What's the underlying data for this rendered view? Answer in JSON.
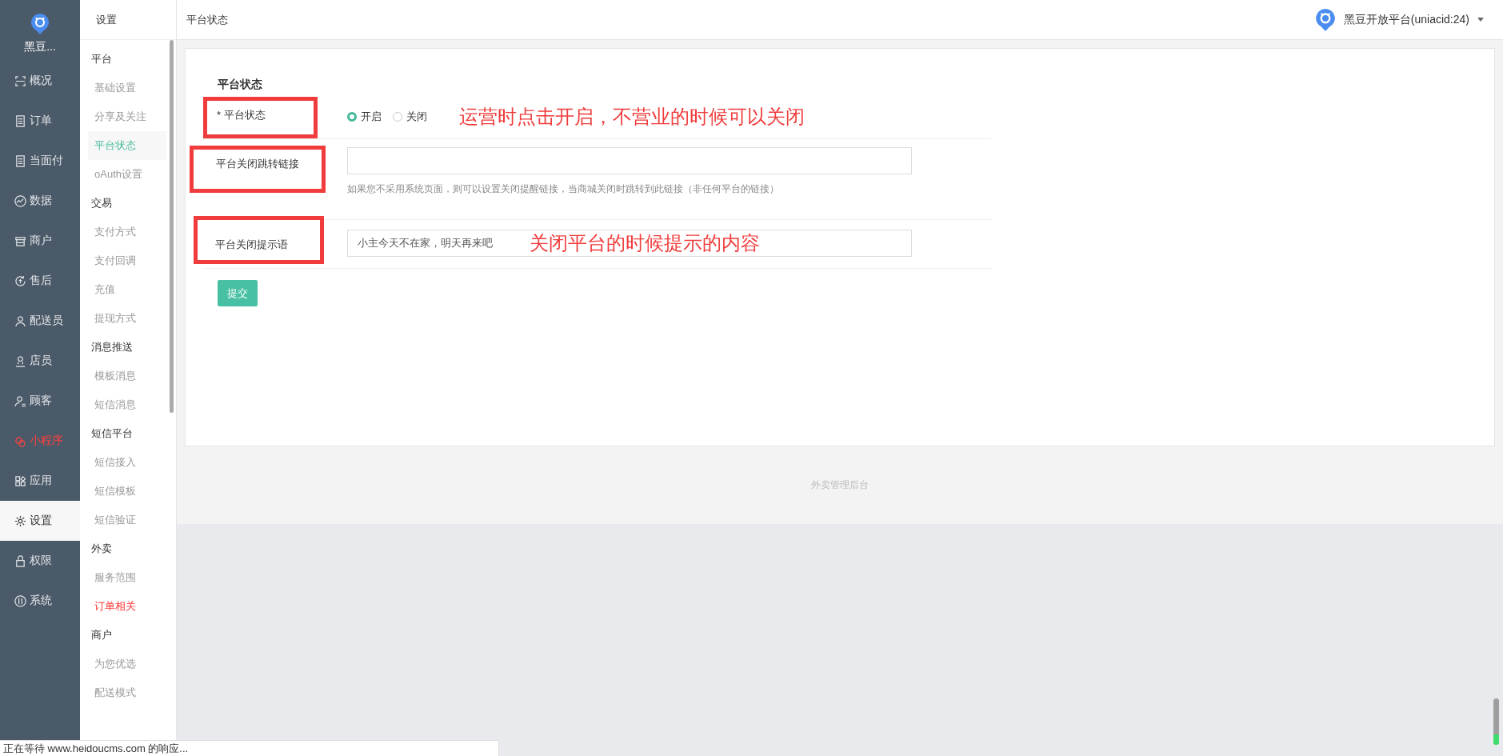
{
  "brand": {
    "name": "黑豆..."
  },
  "nav": [
    {
      "label": "概况",
      "selected": false,
      "highlighted": false
    },
    {
      "label": "订单",
      "selected": false,
      "highlighted": false
    },
    {
      "label": "当面付",
      "selected": false,
      "highlighted": false
    },
    {
      "label": "数据",
      "selected": false,
      "highlighted": false
    },
    {
      "label": "商户",
      "selected": false,
      "highlighted": false
    },
    {
      "label": "售后",
      "selected": false,
      "highlighted": false
    },
    {
      "label": "配送员",
      "selected": false,
      "highlighted": false
    },
    {
      "label": "店员",
      "selected": false,
      "highlighted": false
    },
    {
      "label": "顾客",
      "selected": false,
      "highlighted": false
    },
    {
      "label": "小程序",
      "selected": false,
      "highlighted": true
    },
    {
      "label": "应用",
      "selected": false,
      "highlighted": false
    },
    {
      "label": "设置",
      "selected": true,
      "highlighted": false
    },
    {
      "label": "权限",
      "selected": false,
      "highlighted": false
    },
    {
      "label": "系统",
      "selected": false,
      "highlighted": false
    }
  ],
  "submenu": {
    "title": "设置",
    "groups": [
      {
        "heading": "平台",
        "items": [
          {
            "label": "基础设置",
            "selected": false,
            "highlighted": false
          },
          {
            "label": "分享及关注",
            "selected": false,
            "highlighted": false
          },
          {
            "label": "平台状态",
            "selected": true,
            "highlighted": false
          },
          {
            "label": "oAuth设置",
            "selected": false,
            "highlighted": false
          }
        ]
      },
      {
        "heading": "交易",
        "items": [
          {
            "label": "支付方式",
            "selected": false,
            "highlighted": false
          },
          {
            "label": "支付回调",
            "selected": false,
            "highlighted": false
          },
          {
            "label": "充值",
            "selected": false,
            "highlighted": false
          },
          {
            "label": "提现方式",
            "selected": false,
            "highlighted": false
          }
        ]
      },
      {
        "heading": "消息推送",
        "items": [
          {
            "label": "模板消息",
            "selected": false,
            "highlighted": false
          },
          {
            "label": "短信消息",
            "selected": false,
            "highlighted": false
          }
        ]
      },
      {
        "heading": "短信平台",
        "items": [
          {
            "label": "短信接入",
            "selected": false,
            "highlighted": false
          },
          {
            "label": "短信模板",
            "selected": false,
            "highlighted": false
          },
          {
            "label": "短信验证",
            "selected": false,
            "highlighted": false
          }
        ]
      },
      {
        "heading": "外卖",
        "items": [
          {
            "label": "服务范围",
            "selected": false,
            "highlighted": false
          },
          {
            "label": "订单相关",
            "selected": false,
            "highlighted": true
          }
        ]
      },
      {
        "heading": "商户",
        "items": [
          {
            "label": "为您优选",
            "selected": false,
            "highlighted": false
          },
          {
            "label": "配送模式",
            "selected": false,
            "highlighted": false
          }
        ]
      }
    ]
  },
  "header": {
    "breadcrumb": "平台状态",
    "account": "黑豆开放平台(uniacid:24)"
  },
  "form": {
    "title": "平台状态",
    "fields": [
      {
        "kind": "radio",
        "label": "* 平台状态",
        "options": [
          {
            "label": "开启",
            "selected": true
          },
          {
            "label": "关闭",
            "selected": false
          }
        ],
        "annotation": "运营时点击开启，不营业的时候可以关闭"
      },
      {
        "kind": "text",
        "label": "平台关闭跳转链接",
        "hint": "如果您不采用系统页面，则可以设置关闭提醒链接，当商城关闭时跳转到此链接（非任何平台的链接）"
      },
      {
        "kind": "text",
        "label": "平台关闭提示语",
        "value": "小主今天不在家，明天再来吧",
        "annotation": "关闭平台的时候提示的内容"
      }
    ],
    "submit": "提交"
  },
  "footer": "外卖管理后台",
  "status_bar": "正在等待 www.heidoucms.com 的响应..."
}
